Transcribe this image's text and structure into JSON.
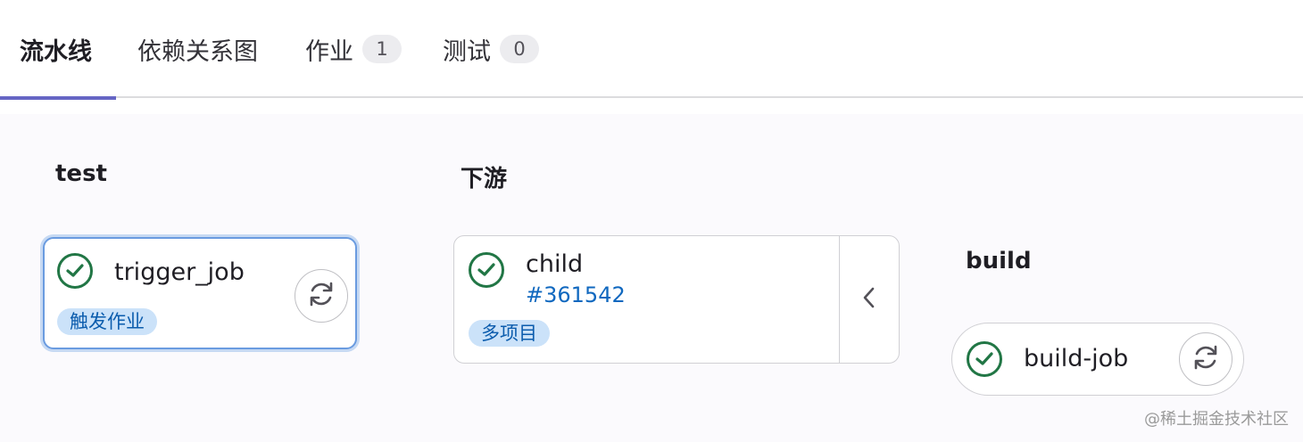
{
  "tabs": [
    {
      "label": "流水线",
      "active": true
    },
    {
      "label": "依赖关系图"
    },
    {
      "label": "作业",
      "count": "1"
    },
    {
      "label": "测试",
      "count": "0"
    }
  ],
  "stages": {
    "test": {
      "title": "test",
      "job": {
        "name": "trigger_job",
        "badge": "触发作业",
        "status": "success",
        "action_icon": "retry-icon"
      }
    },
    "downstream": {
      "title": "下游",
      "job": {
        "name": "child",
        "pipeline_id": "#361542",
        "badge": "多项目",
        "status": "success",
        "action_icon": "chevron-left-icon"
      }
    },
    "build": {
      "title": "build",
      "job": {
        "name": "build-job",
        "status": "success",
        "action_icon": "retry-icon"
      }
    }
  },
  "watermark": "@稀土掘金技术社区",
  "colors": {
    "accent_tab": "#6666c4",
    "success": "#217645",
    "badge_bg": "#cbe2f9",
    "link": "#1068bf",
    "focus_border": "#6a9be0"
  }
}
